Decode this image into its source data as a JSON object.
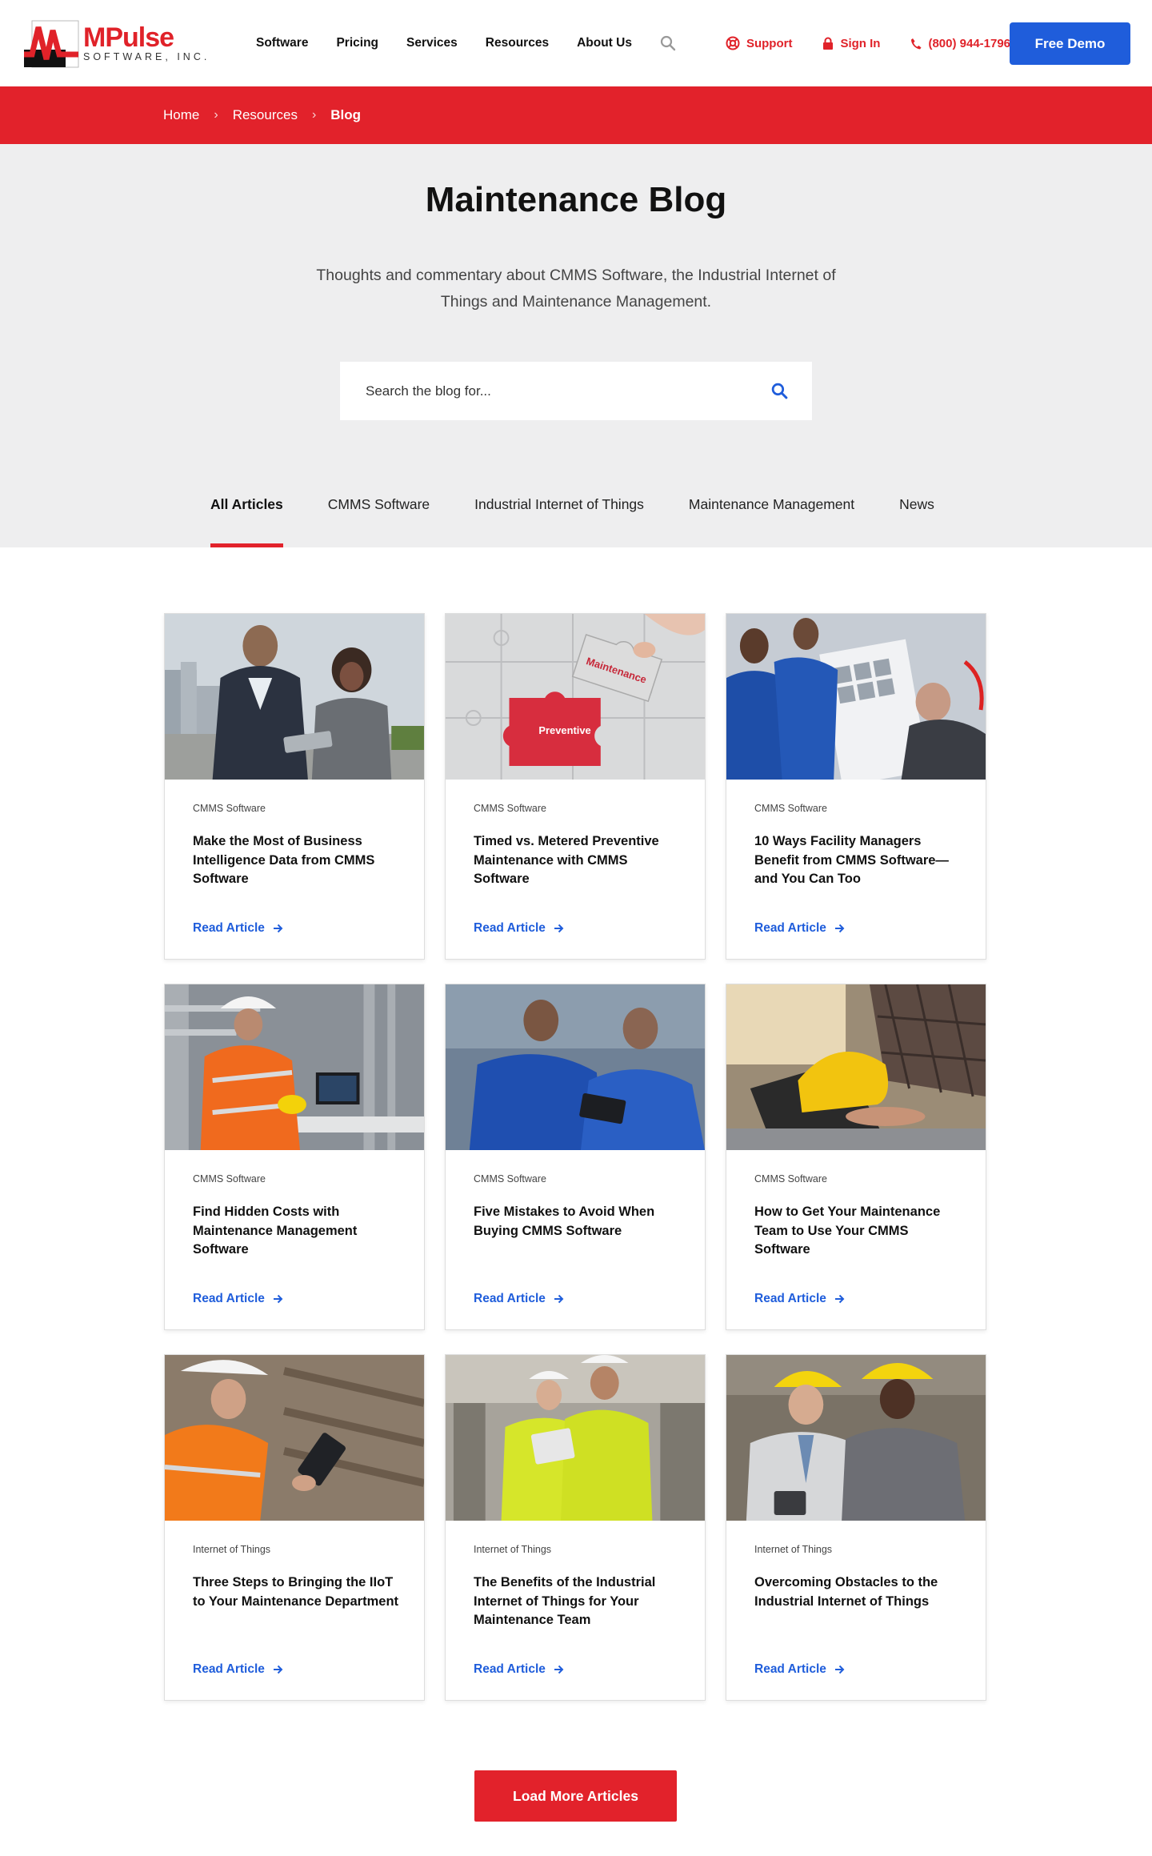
{
  "header": {
    "logo_main": "MPulse",
    "logo_sub": "SOFTWARE, INC.",
    "nav": [
      "Software",
      "Pricing",
      "Services",
      "Resources",
      "About Us"
    ],
    "support_label": "Support",
    "signin_label": "Sign In",
    "phone_label": "(800) 944-1796",
    "demo_label": "Free Demo"
  },
  "breadcrumb": {
    "items": [
      "Home",
      "Resources"
    ],
    "current": "Blog"
  },
  "hero": {
    "title": "Maintenance Blog",
    "subtitle": "Thoughts and commentary about CMMS Software, the Industrial Internet of Things and Maintenance Management.",
    "search_placeholder": "Search the blog for..."
  },
  "tabs": [
    {
      "label": "All Articles",
      "active": true
    },
    {
      "label": "CMMS Software",
      "active": false
    },
    {
      "label": "Industrial Internet of Things",
      "active": false
    },
    {
      "label": "Maintenance Management",
      "active": false
    },
    {
      "label": "News",
      "active": false
    }
  ],
  "cards": [
    {
      "category": "CMMS Software",
      "title": "Make the Most of Business Intelligence Data from CMMS Software",
      "link": "Read Article",
      "image_label": "",
      "image": "business-people-tablet"
    },
    {
      "category": "CMMS Software",
      "title": "Timed vs. Metered Preventive Maintenance with CMMS Software",
      "link": "Read Article",
      "image_label": "Preventive / Maintenance",
      "image": "puzzle"
    },
    {
      "category": "CMMS Software",
      "title": "10 Ways Facility Managers Benefit from CMMS Software—and You Can Too",
      "link": "Read Article",
      "image_label": "",
      "image": "technicians-hvac"
    },
    {
      "category": "CMMS Software",
      "title": "Find Hidden Costs with Maintenance Management Software",
      "link": "Read Article",
      "image_label": "",
      "image": "engineer-vest-laptop"
    },
    {
      "category": "CMMS Software",
      "title": "Five Mistakes to Avoid When Buying CMMS Software",
      "link": "Read Article",
      "image_label": "",
      "image": "workers-blue-tablet"
    },
    {
      "category": "CMMS Software",
      "title": "How to Get Your Maintenance Team to Use Your CMMS Software",
      "link": "Read Article",
      "image_label": "",
      "image": "hardhat-laptop"
    },
    {
      "category": "Internet of Things",
      "title": "Three Steps to Bringing the IIoT to Your Maintenance Department",
      "link": "Read Article",
      "image_label": "",
      "image": "worker-orange-tablet"
    },
    {
      "category": "Internet of Things",
      "title": "The Benefits of the Industrial Internet of Things for Your Maintenance Team",
      "link": "Read Article",
      "image_label": "",
      "image": "workers-yellow-vests"
    },
    {
      "category": "Internet of Things",
      "title": "Overcoming Obstacles to the Industrial Internet of Things",
      "link": "Read Article",
      "image_label": "",
      "image": "workers-yellow-helmets"
    }
  ],
  "load_more_label": "Load More Articles",
  "colors": {
    "brand_red": "#e2222b",
    "brand_blue": "#1f5ddb",
    "hero_bg": "#eeeeef"
  }
}
